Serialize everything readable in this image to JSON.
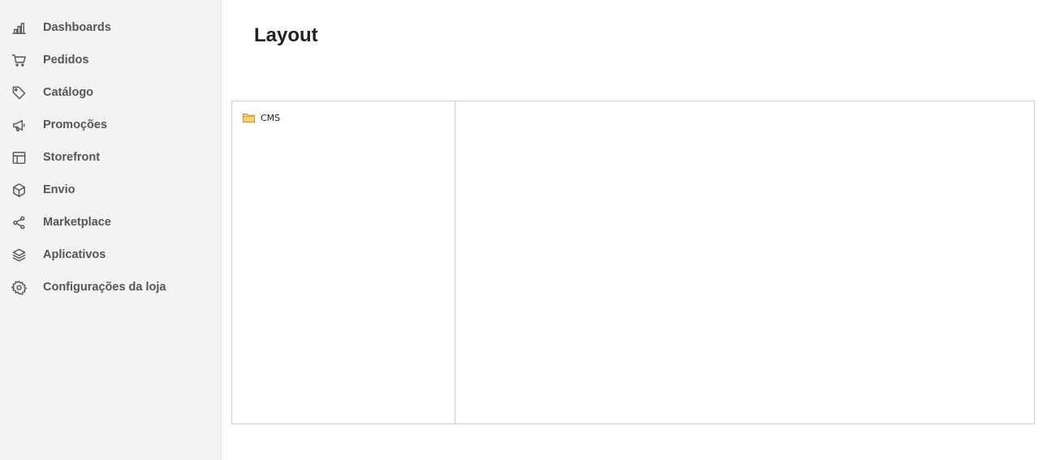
{
  "sidebar": {
    "items": [
      {
        "label": "Dashboards",
        "icon": "bar-chart-icon"
      },
      {
        "label": "Pedidos",
        "icon": "cart-icon"
      },
      {
        "label": "Catálogo",
        "icon": "tag-icon"
      },
      {
        "label": "Promoções",
        "icon": "megaphone-icon"
      },
      {
        "label": "Storefront",
        "icon": "layout-icon"
      },
      {
        "label": "Envio",
        "icon": "box-icon"
      },
      {
        "label": "Marketplace",
        "icon": "share-icon"
      },
      {
        "label": "Aplicativos",
        "icon": "layers-icon"
      },
      {
        "label": "Configurações da loja",
        "icon": "gear-icon"
      }
    ]
  },
  "main": {
    "title": "Layout",
    "tree": {
      "root": {
        "label": "CMS",
        "icon": "folder-icon"
      }
    }
  },
  "colors": {
    "sidebar_bg": "#f3f3f3",
    "text_muted": "#555555",
    "border": "#cfcfcf",
    "folder": "#e8b84a"
  }
}
